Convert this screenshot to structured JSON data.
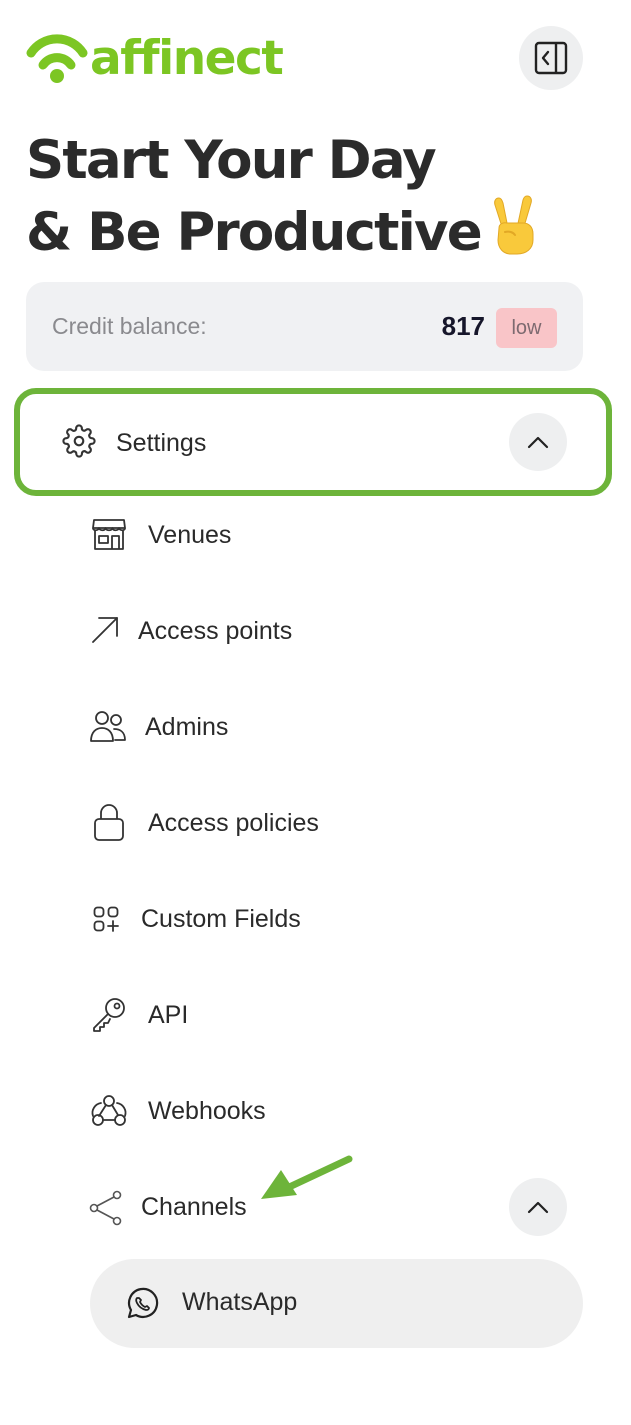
{
  "brand": {
    "name": "affinect",
    "color": "#7cc623"
  },
  "header": {
    "collapse_icon": "sidebar-collapse-icon"
  },
  "headline": {
    "line1": "Start Your Day",
    "line2": "& Be Productive",
    "emoji": "victory-hand-emoji"
  },
  "credit": {
    "label": "Credit balance:",
    "value": "817",
    "badge": "low"
  },
  "settings": {
    "label": "Settings",
    "icon": "gear-icon",
    "expanded": true,
    "highlight_color": "#6db43a"
  },
  "menu": [
    {
      "label": "Venues",
      "icon": "storefront-icon"
    },
    {
      "label": "Access points",
      "icon": "arrow-up-right-icon"
    },
    {
      "label": "Admins",
      "icon": "users-icon"
    },
    {
      "label": "Access policies",
      "icon": "lock-icon"
    },
    {
      "label": "Custom Fields",
      "icon": "grid-plus-icon"
    },
    {
      "label": "API",
      "icon": "key-icon"
    },
    {
      "label": "Webhooks",
      "icon": "webhook-icon"
    },
    {
      "label": "Channels",
      "icon": "share-icon",
      "expanded": true
    }
  ],
  "channels": [
    {
      "label": "WhatsApp",
      "icon": "whatsapp-icon"
    }
  ],
  "annotation": {
    "arrow_color": "#6db43a"
  }
}
